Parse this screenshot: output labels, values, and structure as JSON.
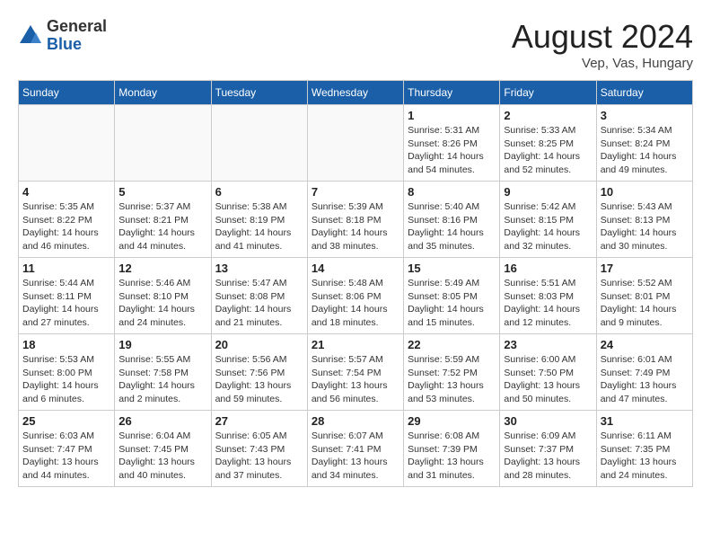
{
  "header": {
    "logo_general": "General",
    "logo_blue": "Blue",
    "month_year": "August 2024",
    "location": "Vep, Vas, Hungary"
  },
  "days_of_week": [
    "Sunday",
    "Monday",
    "Tuesday",
    "Wednesday",
    "Thursday",
    "Friday",
    "Saturday"
  ],
  "weeks": [
    [
      {
        "day": "",
        "info": ""
      },
      {
        "day": "",
        "info": ""
      },
      {
        "day": "",
        "info": ""
      },
      {
        "day": "",
        "info": ""
      },
      {
        "day": "1",
        "info": "Sunrise: 5:31 AM\nSunset: 8:26 PM\nDaylight: 14 hours\nand 54 minutes."
      },
      {
        "day": "2",
        "info": "Sunrise: 5:33 AM\nSunset: 8:25 PM\nDaylight: 14 hours\nand 52 minutes."
      },
      {
        "day": "3",
        "info": "Sunrise: 5:34 AM\nSunset: 8:24 PM\nDaylight: 14 hours\nand 49 minutes."
      }
    ],
    [
      {
        "day": "4",
        "info": "Sunrise: 5:35 AM\nSunset: 8:22 PM\nDaylight: 14 hours\nand 46 minutes."
      },
      {
        "day": "5",
        "info": "Sunrise: 5:37 AM\nSunset: 8:21 PM\nDaylight: 14 hours\nand 44 minutes."
      },
      {
        "day": "6",
        "info": "Sunrise: 5:38 AM\nSunset: 8:19 PM\nDaylight: 14 hours\nand 41 minutes."
      },
      {
        "day": "7",
        "info": "Sunrise: 5:39 AM\nSunset: 8:18 PM\nDaylight: 14 hours\nand 38 minutes."
      },
      {
        "day": "8",
        "info": "Sunrise: 5:40 AM\nSunset: 8:16 PM\nDaylight: 14 hours\nand 35 minutes."
      },
      {
        "day": "9",
        "info": "Sunrise: 5:42 AM\nSunset: 8:15 PM\nDaylight: 14 hours\nand 32 minutes."
      },
      {
        "day": "10",
        "info": "Sunrise: 5:43 AM\nSunset: 8:13 PM\nDaylight: 14 hours\nand 30 minutes."
      }
    ],
    [
      {
        "day": "11",
        "info": "Sunrise: 5:44 AM\nSunset: 8:11 PM\nDaylight: 14 hours\nand 27 minutes."
      },
      {
        "day": "12",
        "info": "Sunrise: 5:46 AM\nSunset: 8:10 PM\nDaylight: 14 hours\nand 24 minutes."
      },
      {
        "day": "13",
        "info": "Sunrise: 5:47 AM\nSunset: 8:08 PM\nDaylight: 14 hours\nand 21 minutes."
      },
      {
        "day": "14",
        "info": "Sunrise: 5:48 AM\nSunset: 8:06 PM\nDaylight: 14 hours\nand 18 minutes."
      },
      {
        "day": "15",
        "info": "Sunrise: 5:49 AM\nSunset: 8:05 PM\nDaylight: 14 hours\nand 15 minutes."
      },
      {
        "day": "16",
        "info": "Sunrise: 5:51 AM\nSunset: 8:03 PM\nDaylight: 14 hours\nand 12 minutes."
      },
      {
        "day": "17",
        "info": "Sunrise: 5:52 AM\nSunset: 8:01 PM\nDaylight: 14 hours\nand 9 minutes."
      }
    ],
    [
      {
        "day": "18",
        "info": "Sunrise: 5:53 AM\nSunset: 8:00 PM\nDaylight: 14 hours\nand 6 minutes."
      },
      {
        "day": "19",
        "info": "Sunrise: 5:55 AM\nSunset: 7:58 PM\nDaylight: 14 hours\nand 2 minutes."
      },
      {
        "day": "20",
        "info": "Sunrise: 5:56 AM\nSunset: 7:56 PM\nDaylight: 13 hours\nand 59 minutes."
      },
      {
        "day": "21",
        "info": "Sunrise: 5:57 AM\nSunset: 7:54 PM\nDaylight: 13 hours\nand 56 minutes."
      },
      {
        "day": "22",
        "info": "Sunrise: 5:59 AM\nSunset: 7:52 PM\nDaylight: 13 hours\nand 53 minutes."
      },
      {
        "day": "23",
        "info": "Sunrise: 6:00 AM\nSunset: 7:50 PM\nDaylight: 13 hours\nand 50 minutes."
      },
      {
        "day": "24",
        "info": "Sunrise: 6:01 AM\nSunset: 7:49 PM\nDaylight: 13 hours\nand 47 minutes."
      }
    ],
    [
      {
        "day": "25",
        "info": "Sunrise: 6:03 AM\nSunset: 7:47 PM\nDaylight: 13 hours\nand 44 minutes."
      },
      {
        "day": "26",
        "info": "Sunrise: 6:04 AM\nSunset: 7:45 PM\nDaylight: 13 hours\nand 40 minutes."
      },
      {
        "day": "27",
        "info": "Sunrise: 6:05 AM\nSunset: 7:43 PM\nDaylight: 13 hours\nand 37 minutes."
      },
      {
        "day": "28",
        "info": "Sunrise: 6:07 AM\nSunset: 7:41 PM\nDaylight: 13 hours\nand 34 minutes."
      },
      {
        "day": "29",
        "info": "Sunrise: 6:08 AM\nSunset: 7:39 PM\nDaylight: 13 hours\nand 31 minutes."
      },
      {
        "day": "30",
        "info": "Sunrise: 6:09 AM\nSunset: 7:37 PM\nDaylight: 13 hours\nand 28 minutes."
      },
      {
        "day": "31",
        "info": "Sunrise: 6:11 AM\nSunset: 7:35 PM\nDaylight: 13 hours\nand 24 minutes."
      }
    ]
  ]
}
